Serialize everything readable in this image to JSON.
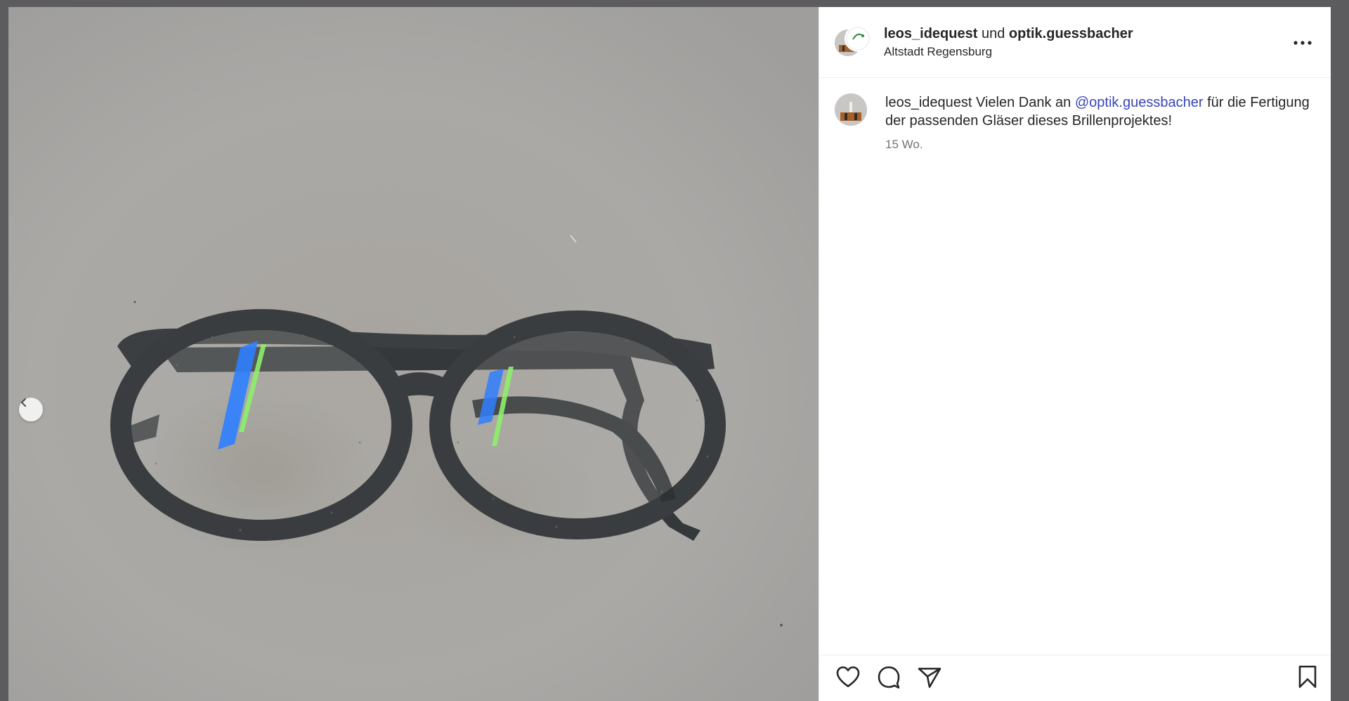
{
  "post": {
    "author": "leos_idequest",
    "joiner": "und",
    "collaborator": "optik.guessbacher",
    "location": "Altstadt Regensburg"
  },
  "caption": {
    "username": "leos_idequest",
    "text_before": "Vielen Dank an",
    "mention": "@optik.guessbacher",
    "text_after": "für die Fertigung der passenden Gläser dieses Brillenprojektes!",
    "time": "15 Wo."
  },
  "icons": {
    "more": "more-horizontal-icon",
    "prev": "chevron-left-icon",
    "like": "heart-icon",
    "comment": "comment-bubble-icon",
    "share": "paper-plane-icon",
    "save": "bookmark-icon"
  },
  "colors": {
    "mention": "#3946b8",
    "text": "#262626",
    "muted": "#737373",
    "photo_background": "#a9a8a5",
    "frame": "#3a3d3e"
  }
}
